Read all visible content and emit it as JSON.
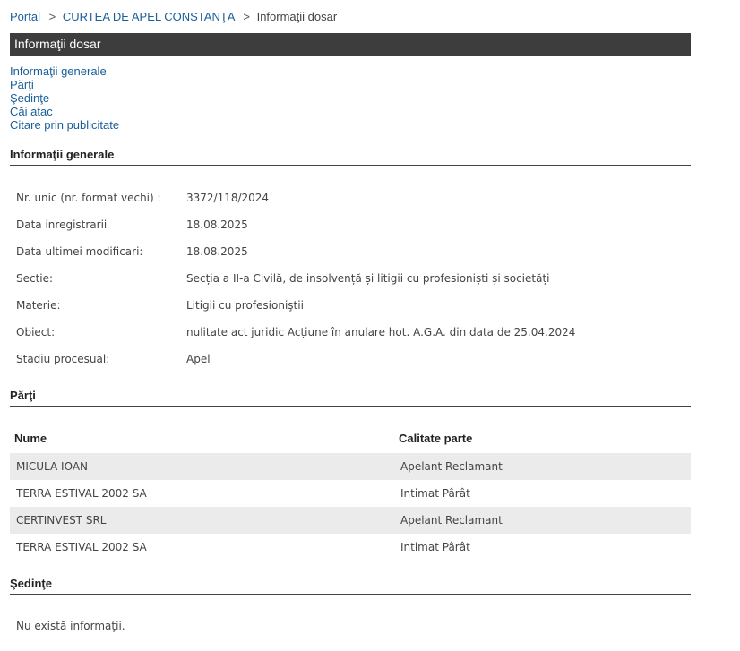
{
  "breadcrumb": {
    "portal": "Portal",
    "court": "CURTEA DE APEL CONSTANŢA",
    "current": "Informaţii dosar",
    "separator": ">"
  },
  "title": "Informaţii dosar",
  "nav_links": [
    "Informaţii generale",
    "Părţi",
    "Şedinţe",
    "Căi atac",
    "Citare prin publicitate"
  ],
  "general": {
    "heading": "Informaţii generale",
    "rows": [
      {
        "label": "Nr. unic (nr. format vechi) :",
        "value": "3372/118/2024"
      },
      {
        "label": "Data inregistrarii",
        "value": "18.08.2025"
      },
      {
        "label": "Data ultimei modificari:",
        "value": "18.08.2025"
      },
      {
        "label": "Sectie:",
        "value": "Secția a II-a Civilă, de insolvență și litigii cu profesioniști și societăți"
      },
      {
        "label": "Materie:",
        "value": "Litigii cu profesioniştii"
      },
      {
        "label": "Obiect:",
        "value": "nulitate act juridic Acțiune în anulare hot. A.G.A. din data de 25.04.2024"
      },
      {
        "label": "Stadiu procesual:",
        "value": "Apel"
      }
    ]
  },
  "parties": {
    "heading": "Părţi",
    "col_name": "Nume",
    "col_role": "Calitate parte",
    "rows": [
      {
        "name": "MICULA IOAN",
        "role": "Apelant Reclamant"
      },
      {
        "name": "TERRA ESTIVAL 2002 SA",
        "role": "Intimat Pârât"
      },
      {
        "name": "CERTINVEST SRL",
        "role": "Apelant Reclamant"
      },
      {
        "name": "TERRA ESTIVAL 2002 SA",
        "role": "Intimat Pârât"
      }
    ]
  },
  "hearings": {
    "heading": "Şedinţe",
    "empty": "Nu există informaţii."
  }
}
